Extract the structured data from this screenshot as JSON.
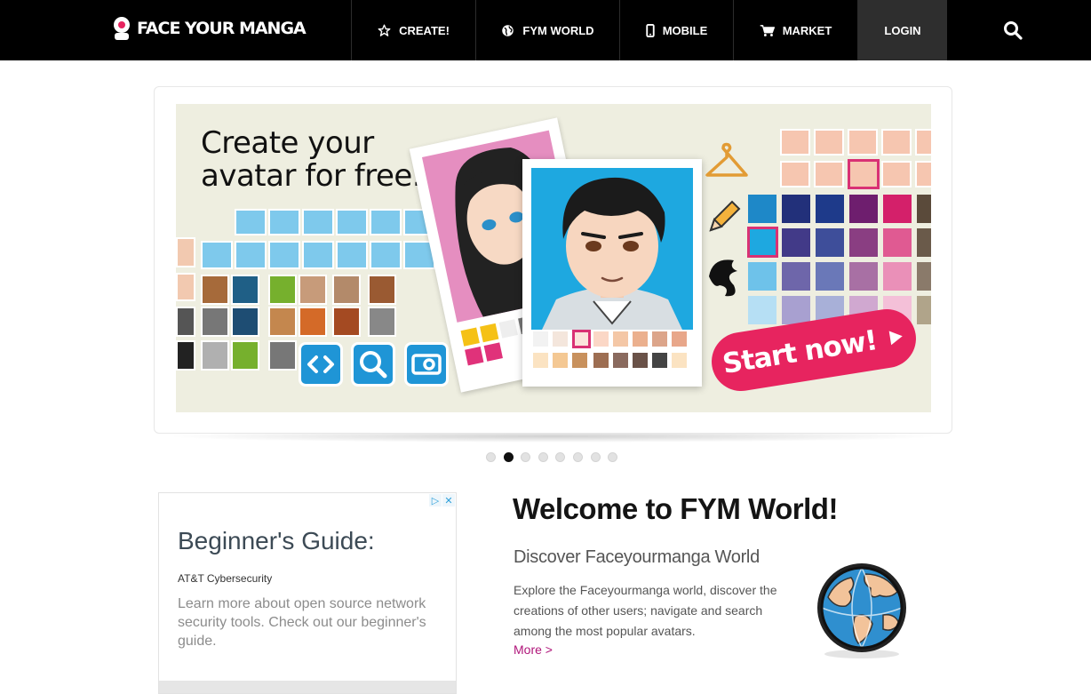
{
  "brand": {
    "name": "FACE YOUR MANGA"
  },
  "nav": {
    "items": [
      {
        "label": "CREATE!",
        "icon": "star-icon"
      },
      {
        "label": "FYM WORLD",
        "icon": "globe-icon"
      },
      {
        "label": "MOBILE",
        "icon": "mobile-icon"
      },
      {
        "label": "MARKET",
        "icon": "cart-icon"
      },
      {
        "label": "LOGIN"
      }
    ],
    "search_icon": "search-icon"
  },
  "hero": {
    "title_line1": "Create your",
    "title_line2": "avatar for free.",
    "cta_label": "Start now!",
    "slides_total": 8,
    "active_slide": 2
  },
  "ad": {
    "title": "Beginner's Guide:",
    "sponsor": "AT&T Cybersecurity",
    "body": "Learn more about open source network security tools. Check out our beginner's guide.",
    "badge_icons": [
      "adchoices-icon",
      "close-icon"
    ]
  },
  "welcome": {
    "title": "Welcome to FYM World!",
    "subtitle": "Discover Faceyourmanga World",
    "body": "Explore the Faceyourmanga world, discover the creations of other users; navigate and search among the most popular avatars.",
    "more_label": "More >"
  },
  "colors": {
    "nav_bg": "#000000",
    "accent_pink": "#e7245f",
    "link": "#b0167a",
    "tool_blue": "#1f95d6"
  }
}
